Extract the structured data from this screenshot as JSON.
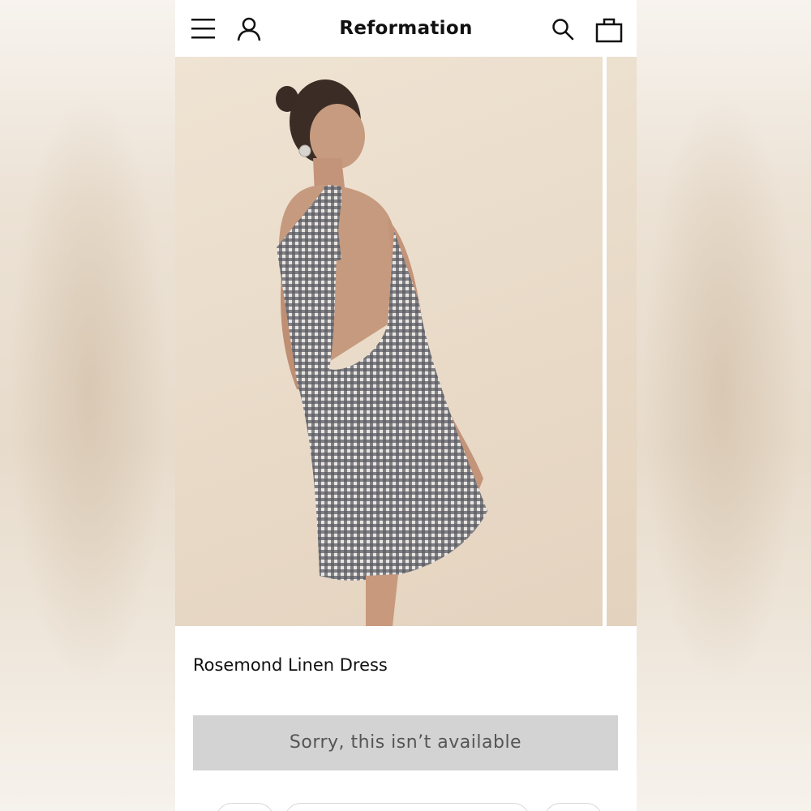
{
  "header": {
    "brand": "Reformation",
    "icons": [
      "menu-icon",
      "account-icon",
      "search-icon",
      "bag-icon"
    ]
  },
  "product": {
    "name": "Rosemond Linen Dress",
    "status_button": "Sorry, this isn’t available"
  },
  "colors": {
    "button_bg": "#d3d3d3",
    "button_text": "#555555",
    "photo_bg": "#eadcca"
  }
}
